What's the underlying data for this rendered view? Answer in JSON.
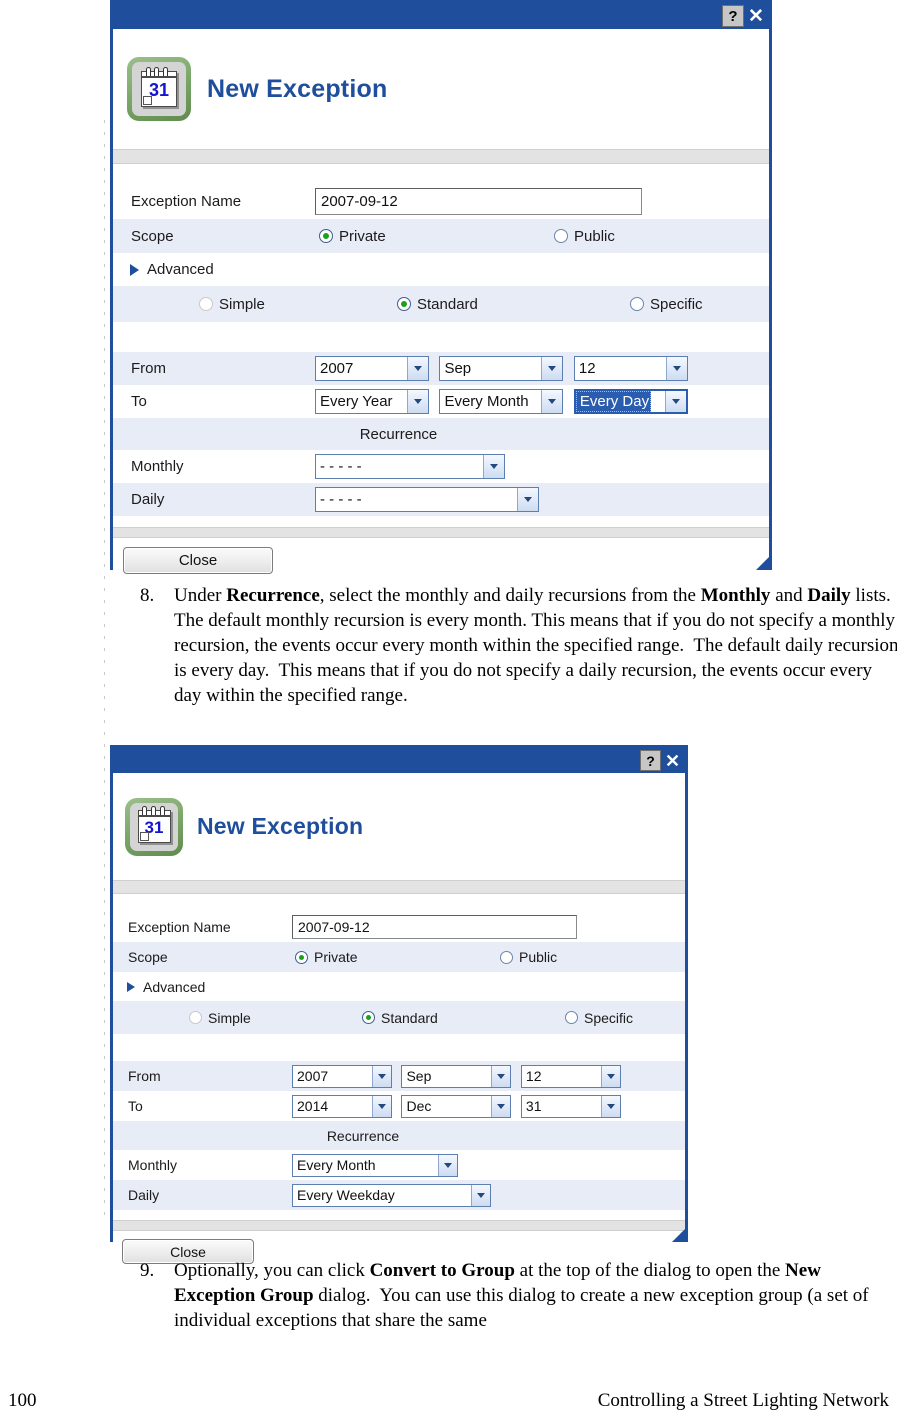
{
  "document": {
    "footer": {
      "page_number": "100",
      "title": "Controlling a Street Lighting Network"
    },
    "steps": [
      {
        "number": "8.",
        "segments": [
          {
            "text": "Under ",
            "bold": false
          },
          {
            "text": "Recurrence",
            "bold": true
          },
          {
            "text": ", select the monthly and daily recursions from the ",
            "bold": false
          },
          {
            "text": "Monthly",
            "bold": true
          },
          {
            "text": " and ",
            "bold": false
          },
          {
            "text": "Daily",
            "bold": true
          },
          {
            "text": " lists.  The default monthly recursion is every month.  This means that if you do not specify a monthly recursion, the events occur every month within the specified range.  The default daily recursion is every day.  This means that if you do not specify a daily recursion, the events occur every day within the specified range.",
            "bold": false
          }
        ]
      },
      {
        "number": "9.",
        "segments": [
          {
            "text": "Optionally, you can click ",
            "bold": false
          },
          {
            "text": "Convert to Group",
            "bold": true
          },
          {
            "text": " at the top of the dialog to open the ",
            "bold": false
          },
          {
            "text": "New Exception Group",
            "bold": true
          },
          {
            "text": " dialog.  You can use this dialog to create a new exception group (a set of individual exceptions that share the same",
            "bold": false
          }
        ]
      }
    ]
  },
  "colors": {
    "title_bar": "#1f4e9c",
    "dialog_title_text": "#1f4e9c",
    "radio_selected_dot": "#19a319",
    "row_alt_background": "#e8ecf7",
    "selection_highlight": "#2a5cb0",
    "icon_green": "#7ea96c",
    "calendar_number": "#1414d2"
  },
  "dialog1": {
    "titlebar": {
      "help_label": "?",
      "close_label": "✕"
    },
    "icon": {
      "name": "calendar-icon",
      "day_number": "31"
    },
    "title": "New Exception",
    "fields": {
      "exception_name_label": "Exception Name",
      "exception_name_value": "2007-09-12",
      "scope_label": "Scope",
      "scope_options": [
        {
          "label": "Private",
          "selected": true,
          "disabled": false
        },
        {
          "label": "Public",
          "selected": false,
          "disabled": false
        }
      ],
      "advanced_label": "Advanced",
      "mode_options": [
        {
          "label": "Simple",
          "selected": false,
          "disabled": true
        },
        {
          "label": "Standard",
          "selected": true,
          "disabled": false
        },
        {
          "label": "Specific",
          "selected": false,
          "disabled": false
        }
      ],
      "from_label": "From",
      "from_year": "2007",
      "from_month": "Sep",
      "from_day": "12",
      "to_label": "To",
      "to_year": "Every Year",
      "to_month": "Every Month",
      "to_day": "Every Day",
      "recurrence_label": "Recurrence",
      "monthly_label": "Monthly",
      "monthly_value": "- - - - -",
      "daily_label": "Daily",
      "daily_value": "- - - - -"
    },
    "close_button": "Close"
  },
  "dialog2": {
    "titlebar": {
      "help_label": "?",
      "close_label": "✕"
    },
    "icon": {
      "name": "calendar-icon",
      "day_number": "31"
    },
    "title": "New Exception",
    "fields": {
      "exception_name_label": "Exception Name",
      "exception_name_value": "2007-09-12",
      "scope_label": "Scope",
      "scope_options": [
        {
          "label": "Private",
          "selected": true,
          "disabled": false
        },
        {
          "label": "Public",
          "selected": false,
          "disabled": false
        }
      ],
      "advanced_label": "Advanced",
      "mode_options": [
        {
          "label": "Simple",
          "selected": false,
          "disabled": true
        },
        {
          "label": "Standard",
          "selected": true,
          "disabled": false
        },
        {
          "label": "Specific",
          "selected": false,
          "disabled": false
        }
      ],
      "from_label": "From",
      "from_year": "2007",
      "from_month": "Sep",
      "from_day": "12",
      "to_label": "To",
      "to_year": "2014",
      "to_month": "Dec",
      "to_day": "31",
      "recurrence_label": "Recurrence",
      "monthly_label": "Monthly",
      "monthly_value": "Every Month",
      "daily_label": "Daily",
      "daily_value": "Every Weekday"
    },
    "close_button": "Close"
  }
}
